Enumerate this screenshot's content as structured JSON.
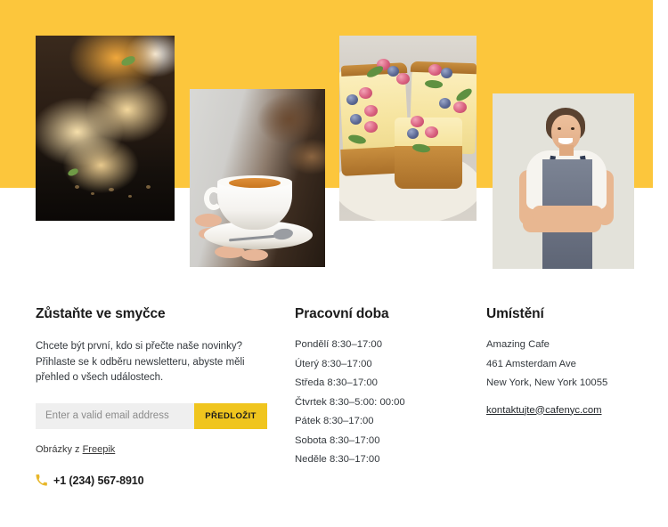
{
  "theme": {
    "banner_yellow": "#fcc63c",
    "button_yellow": "#f0c51e",
    "text_dark": "#1b1b1b",
    "text_body": "#33383d",
    "input_bg": "#efefef"
  },
  "gallery": {
    "images": [
      {
        "name": "sliced-bread-loaf",
        "alt": "Sliced fruit bread loaf on a dark wooden board"
      },
      {
        "name": "hands-holding-coffee-cup",
        "alt": "Hands holding a white cup of coffee on a saucer with spoon"
      },
      {
        "name": "cheesecake-slices-with-berries",
        "alt": "Cheesecake slices topped with raspberries, blueberries and mint"
      },
      {
        "name": "smiling-woman-in-apron",
        "alt": "Smiling woman wearing a denim apron with arms crossed"
      }
    ]
  },
  "newsletter": {
    "title": "Zůstaňte ve smyčce",
    "blurb": "Chcete být první, kdo si přečte naše novinky? Přihlaste se k odběru newsletteru, abyste měli přehled o všech událostech.",
    "email_placeholder": "Enter a valid email address",
    "email_value": "",
    "submit_label": "PŘEDLOŽIT",
    "credit_prefix": "Obrázky z ",
    "credit_link": "Freepik",
    "phone": "+1 (234) 567-8910",
    "phone_icon": "phone-icon"
  },
  "hours": {
    "title": "Pracovní doba",
    "entries": [
      "Pondělí 8:30–17:00",
      "Úterý 8:30–17:00",
      "Středa 8:30–17:00",
      "Čtvrtek 8:30–5:00: 00:00",
      "Pátek 8:30–17:00",
      "Sobota 8:30–17:00",
      "Neděle 8:30–17:00"
    ]
  },
  "location": {
    "title": "Umístění",
    "address": [
      "Amazing Cafe",
      "461 Amsterdam Ave",
      "New York, New York 10055"
    ],
    "email": "kontaktujte@cafenyc.com"
  }
}
